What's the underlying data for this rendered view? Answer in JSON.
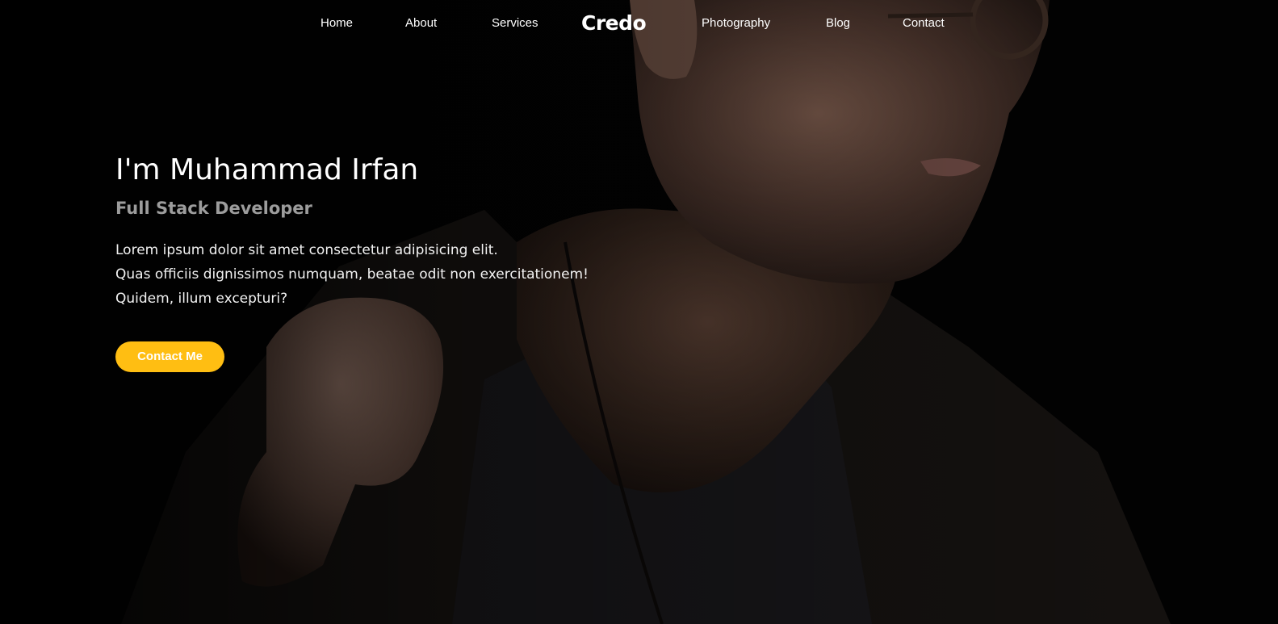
{
  "nav": {
    "items": [
      {
        "label": "Home"
      },
      {
        "label": "About"
      },
      {
        "label": "Services"
      },
      {
        "label": "Photography"
      },
      {
        "label": "Blog"
      },
      {
        "label": "Contact"
      }
    ],
    "brand": "Credo"
  },
  "hero": {
    "title": "I'm Muhammad Irfan",
    "subtitle": "Full Stack Developer",
    "description": [
      "Lorem ipsum dolor sit amet consectetur adipisicing elit.",
      "Quas officiis dignissimos numquam, beatae odit non exercitationem!",
      "Quidem, illum excepturi?"
    ],
    "cta_label": "Contact Me"
  },
  "colors": {
    "background": "#000000",
    "accent": "#ffbe12",
    "subtitle": "#9c9c9c"
  }
}
